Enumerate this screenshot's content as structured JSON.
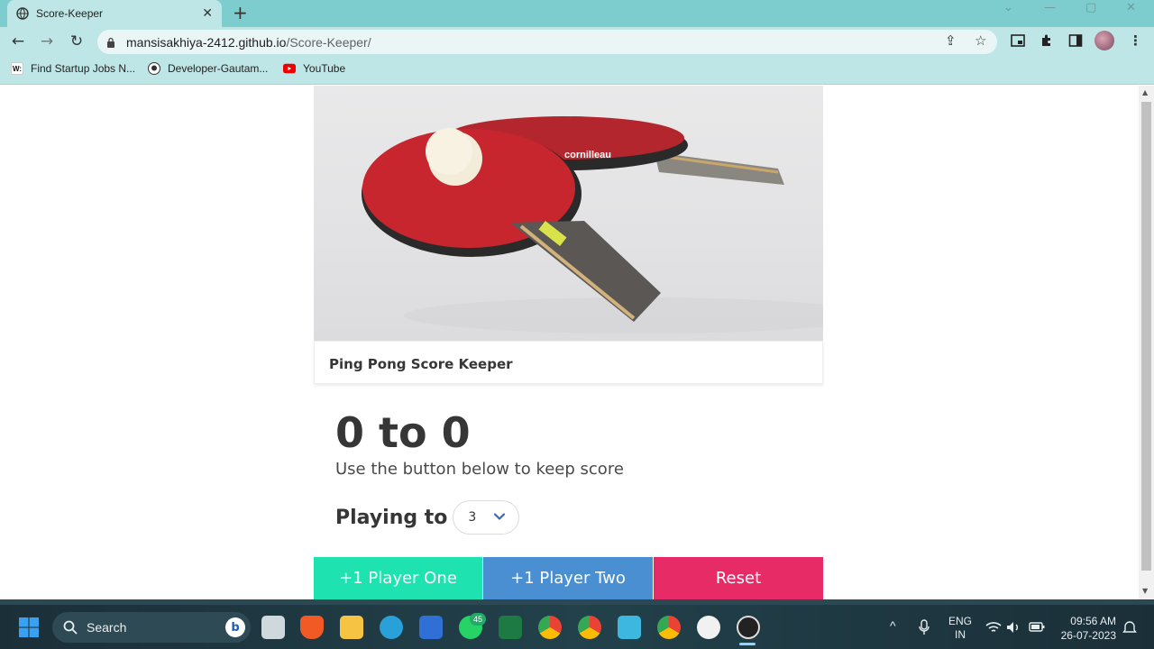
{
  "browser": {
    "tab_title": "Score-Keeper",
    "url_host": "mansisakhiya-2412.github.io",
    "url_path": "/Score-Keeper/",
    "bookmarks": [
      "Find Startup Jobs N...",
      "Developer-Gautam...",
      "YouTube"
    ]
  },
  "card": {
    "title": "Ping Pong Score Keeper",
    "score_text": "0 to 0",
    "subtitle": "Use the button below to keep score",
    "playing_to_label": "Playing to",
    "playing_to_value": "3"
  },
  "buttons": {
    "player_one": "+1 Player One",
    "player_two": "+1 Player Two",
    "reset": "Reset"
  },
  "colors": {
    "player_one": "#1ee3b1",
    "player_two": "#4a8fd1",
    "reset": "#e72b67",
    "browser_frame": "#7ecdce"
  },
  "taskbar": {
    "search_label": "Search",
    "whatsapp_badge": "45",
    "lang_line1": "ENG",
    "lang_line2": "IN",
    "time": "09:56 AM",
    "date": "26-07-2023"
  }
}
